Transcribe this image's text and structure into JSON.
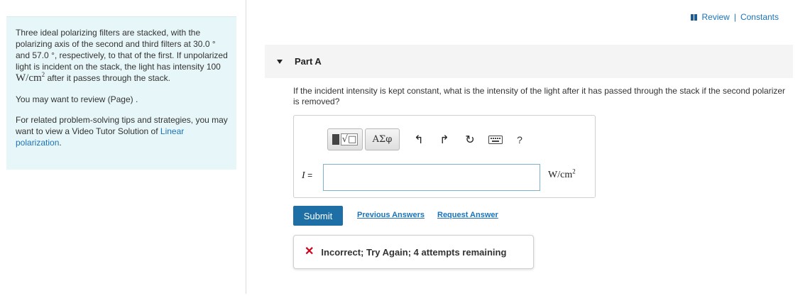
{
  "problem": {
    "line_a": "Three ideal polarizing filters are stacked, with the polarizing axis of the second and third filters at 30.0",
    "line_b": "and 57.0",
    "line_c": ", respectively, to that of the first. If unpolarized light is incident on the stack, the light has intensity 100",
    "intensity_unit_base": "W/cm",
    "intensity_unit_exp": "2",
    "line_d": "after it passes through the stack.",
    "degree_symbol": "°",
    "review_text": "You may want to review (Page) .",
    "tips_text": "For related problem-solving tips and strategies, you may want to view a Video Tutor Solution of",
    "tips_link": "Linear polarization",
    "tips_end": "."
  },
  "header": {
    "review_label": "Review",
    "separator": "|",
    "constants_label": "Constants"
  },
  "part": {
    "title": "Part A",
    "question": "If the incident intensity is kept constant, what is the intensity of the light after it has passed through the stack if the second polarizer is removed?"
  },
  "toolbar": {
    "greek_label": "ΑΣφ",
    "undo_glyph": "↰",
    "redo_glyph": "↱",
    "reset_glyph": "↻",
    "help_label": "?"
  },
  "answer": {
    "variable": "I",
    "equals": "=",
    "value": "",
    "unit_base": "W/cm",
    "unit_exp": "2"
  },
  "actions": {
    "submit_label": "Submit",
    "previous_answers_label": "Previous Answers",
    "request_answer_label": "Request Answer"
  },
  "feedback": {
    "text": "Incorrect; Try Again; 4 attempts remaining",
    "color": "#d0021b"
  },
  "colors": {
    "accent": "#1d6fa5",
    "link": "#1a73b8",
    "panel_bg": "#e7f6f8"
  }
}
